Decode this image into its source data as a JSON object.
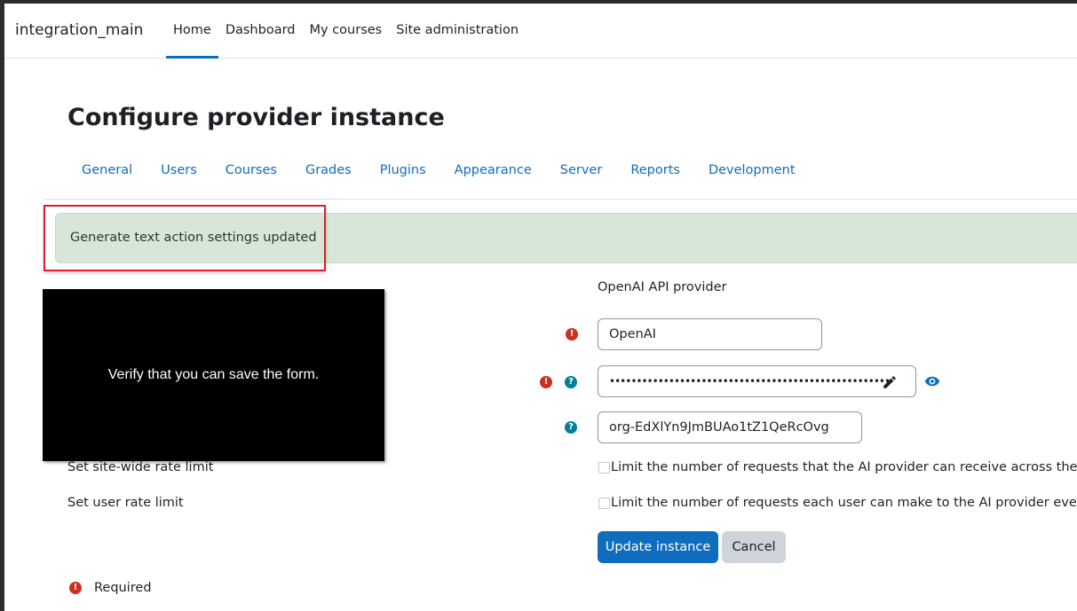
{
  "brand": "integration_main",
  "primary_nav": [
    "Home",
    "Dashboard",
    "My courses",
    "Site administration"
  ],
  "page_title": "Configure provider instance",
  "secondary_nav": [
    "General",
    "Users",
    "Courses",
    "Grades",
    "Plugins",
    "Appearance",
    "Server",
    "Reports",
    "Development"
  ],
  "alert": {
    "message": "Generate text action settings updated"
  },
  "overlay": {
    "text": "Verify that you can save the form."
  },
  "form": {
    "provider_plugin": "OpenAI API provider",
    "instance_name": "OpenAI",
    "api_key_mask": "••••••••••••••••••••••••••••••••••••••••••••••••••••",
    "org_id": "org-EdXlYn9JmBUAo1tZ1QeRcOvg",
    "site_rate_label": "Set site-wide rate limit",
    "site_rate_check": "Limit the number of requests that the AI provider can receive across the entire",
    "user_rate_label": "Set user rate limit",
    "user_rate_check": "Limit the number of requests each user can make to the AI provider every hou",
    "update_button": "Update instance",
    "cancel_button": "Cancel",
    "required_text": "Required"
  },
  "colors": {
    "accent": "#0f6cbf",
    "required": "#ca3120",
    "help": "#008196",
    "alert_bg": "#d7e6d8"
  }
}
